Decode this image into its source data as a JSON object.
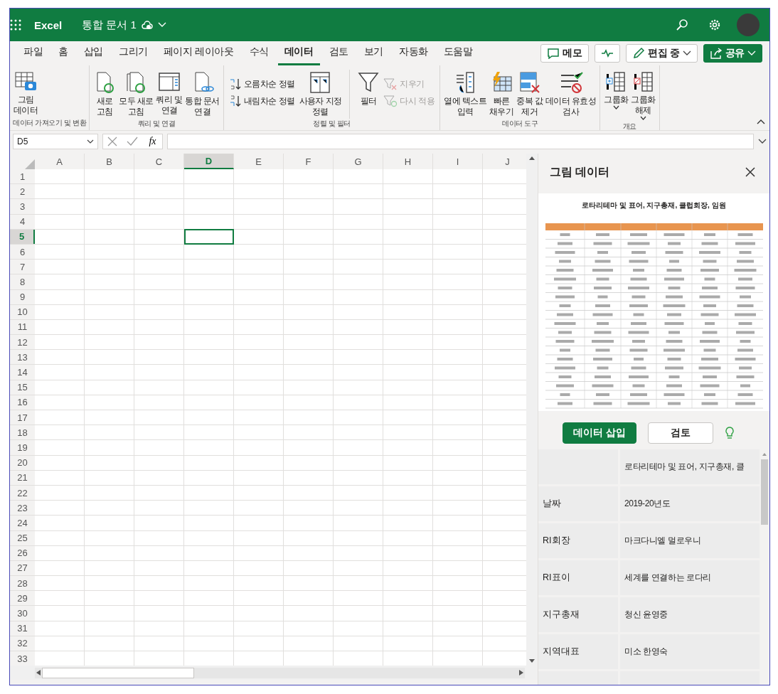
{
  "app": {
    "name": "Excel",
    "doc_title": "통합 문서 1"
  },
  "tabs": [
    {
      "label": "파일",
      "selected": false
    },
    {
      "label": "홈",
      "selected": false
    },
    {
      "label": "삽입",
      "selected": false
    },
    {
      "label": "그리기",
      "selected": false
    },
    {
      "label": "페이지 레이아웃",
      "selected": false
    },
    {
      "label": "수식",
      "selected": false
    },
    {
      "label": "데이터",
      "selected": true
    },
    {
      "label": "검토",
      "selected": false
    },
    {
      "label": "보기",
      "selected": false
    },
    {
      "label": "자동화",
      "selected": false
    },
    {
      "label": "도움말",
      "selected": false
    }
  ],
  "actions": [
    {
      "kind": "outline",
      "label": "메모"
    },
    {
      "kind": "icon"
    },
    {
      "kind": "dropdown",
      "label": "편집 중"
    },
    {
      "kind": "primary",
      "label": "공유"
    }
  ],
  "ribbon": [
    {
      "label": "데이터 가져오기 및 변환",
      "items": [
        {
          "kind": "large",
          "label": "그림\n데이터",
          "dropdown": false
        }
      ]
    },
    {
      "label": "쿼리 및 연결",
      "items": [
        {
          "kind": "large",
          "label": "새로\n고침",
          "dropdown": false
        },
        {
          "kind": "large",
          "label": "모두 새로\n고침",
          "dropdown": false
        },
        {
          "kind": "large",
          "label": "쿼리 및\n연결",
          "dropdown": false
        },
        {
          "kind": "large",
          "label": "통합 문서\n연결",
          "dropdown": false
        }
      ]
    },
    {
      "label": "정렬 및 필터",
      "items": [
        {
          "kind": "stack",
          "items": [
            {
              "label": "오름차순 정렬",
              "disabled": false
            },
            {
              "label": "내림차순 정렬",
              "disabled": false
            }
          ]
        },
        {
          "kind": "large",
          "label": "사용자 지정\n정렬",
          "dropdown": false
        },
        {
          "kind": "divider"
        },
        {
          "kind": "large",
          "label": "필터",
          "dropdown": false
        },
        {
          "kind": "stack",
          "items": [
            {
              "label": "지우기",
              "disabled": true
            },
            {
              "label": "다시 적용",
              "disabled": true
            }
          ]
        }
      ]
    },
    {
      "label": "데이터 도구",
      "items": [
        {
          "kind": "large",
          "label": "열에 텍스트\n입력",
          "dropdown": false
        },
        {
          "kind": "large",
          "label": "빠른\n채우기",
          "dropdown": false
        },
        {
          "kind": "large",
          "label": "중복 값\n제거",
          "dropdown": false
        },
        {
          "kind": "large",
          "label": "데이터 유효성\n검사",
          "dropdown": false
        }
      ]
    },
    {
      "label": "개요",
      "items": [
        {
          "kind": "large",
          "label": "그룹화",
          "dropdown": true
        },
        {
          "kind": "large",
          "label": "그룹화\n해제",
          "dropdown": true
        }
      ]
    }
  ],
  "formula_bar": {
    "name_box": "D5",
    "function_label": "fx"
  },
  "sheet": {
    "columns": [
      {
        "label": "A",
        "selected": false
      },
      {
        "label": "B",
        "selected": false
      },
      {
        "label": "C",
        "selected": false
      },
      {
        "label": "D",
        "selected": true
      },
      {
        "label": "E",
        "selected": false
      },
      {
        "label": "F",
        "selected": false
      },
      {
        "label": "G",
        "selected": false
      },
      {
        "label": "H",
        "selected": false
      },
      {
        "label": "I",
        "selected": false
      },
      {
        "label": "J",
        "selected": false
      }
    ],
    "rows": [
      {
        "label": "1",
        "selected": false
      },
      {
        "label": "2",
        "selected": false
      },
      {
        "label": "3",
        "selected": false
      },
      {
        "label": "4",
        "selected": false
      },
      {
        "label": "5",
        "selected": true
      },
      {
        "label": "6",
        "selected": false
      },
      {
        "label": "7",
        "selected": false
      },
      {
        "label": "8",
        "selected": false
      },
      {
        "label": "9",
        "selected": false
      },
      {
        "label": "10",
        "selected": false
      },
      {
        "label": "11",
        "selected": false
      },
      {
        "label": "12",
        "selected": false
      },
      {
        "label": "13",
        "selected": false
      },
      {
        "label": "14",
        "selected": false
      },
      {
        "label": "15",
        "selected": false
      },
      {
        "label": "16",
        "selected": false
      },
      {
        "label": "17",
        "selected": false
      },
      {
        "label": "18",
        "selected": false
      },
      {
        "label": "19",
        "selected": false
      },
      {
        "label": "20",
        "selected": false
      },
      {
        "label": "21",
        "selected": false
      },
      {
        "label": "22",
        "selected": false
      },
      {
        "label": "23",
        "selected": false
      },
      {
        "label": "24",
        "selected": false
      },
      {
        "label": "25",
        "selected": false
      },
      {
        "label": "26",
        "selected": false
      },
      {
        "label": "27",
        "selected": false
      },
      {
        "label": "28",
        "selected": false
      },
      {
        "label": "29",
        "selected": false
      },
      {
        "label": "30",
        "selected": false
      },
      {
        "label": "31",
        "selected": false
      },
      {
        "label": "32",
        "selected": false
      },
      {
        "label": "33",
        "selected": false
      }
    ]
  },
  "panel": {
    "title": "그림 데이터",
    "image_title": "로타리테마 및 표어, 지구총재, 클럽회장, 임원",
    "buttons": [
      {
        "kind": "primary",
        "label": "데이터 삽입"
      },
      {
        "kind": "secondary",
        "label": "검토"
      }
    ],
    "rows": [
      [
        "",
        "로타리테마 및 표어, 지구총재, 클"
      ],
      [
        "날짜",
        "2019-20년도"
      ],
      [
        "RI회장",
        "마크다니엘 멀로우니"
      ],
      [
        "RI표이",
        "세계를 연결하는 로다리"
      ],
      [
        "지구총재",
        "청신 윤영중"
      ],
      [
        "지역대표",
        "미소 한영숙"
      ],
      [
        "",
        ""
      ]
    ]
  }
}
